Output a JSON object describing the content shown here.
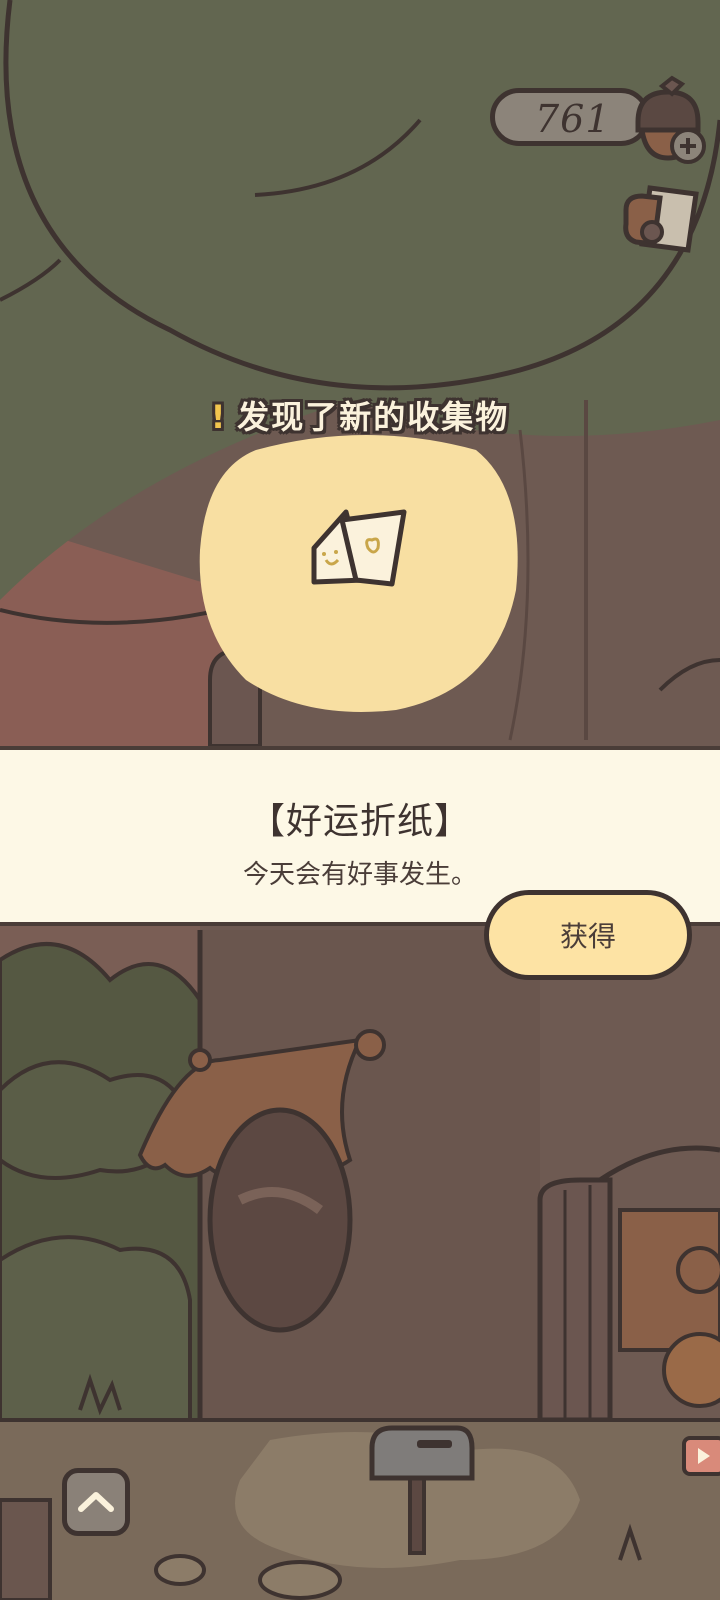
{
  "hud": {
    "acorn_count": "761"
  },
  "discovery": {
    "title": "发现了新的收集物",
    "item_name": "【好运折纸】",
    "item_description": "今天会有好事发生。",
    "obtain_button": "获得"
  },
  "colors": {
    "panel_bg": "#fdf8e6",
    "button_bg": "#fde3a4",
    "outline": "#3e3330",
    "accent_yellow": "#f2c64e"
  },
  "icons": [
    "acorn-add-icon",
    "postcard-collection-icon",
    "folded-paper-charm-icon",
    "chevron-up-icon",
    "mailbox-icon",
    "video-ad-icon"
  ]
}
